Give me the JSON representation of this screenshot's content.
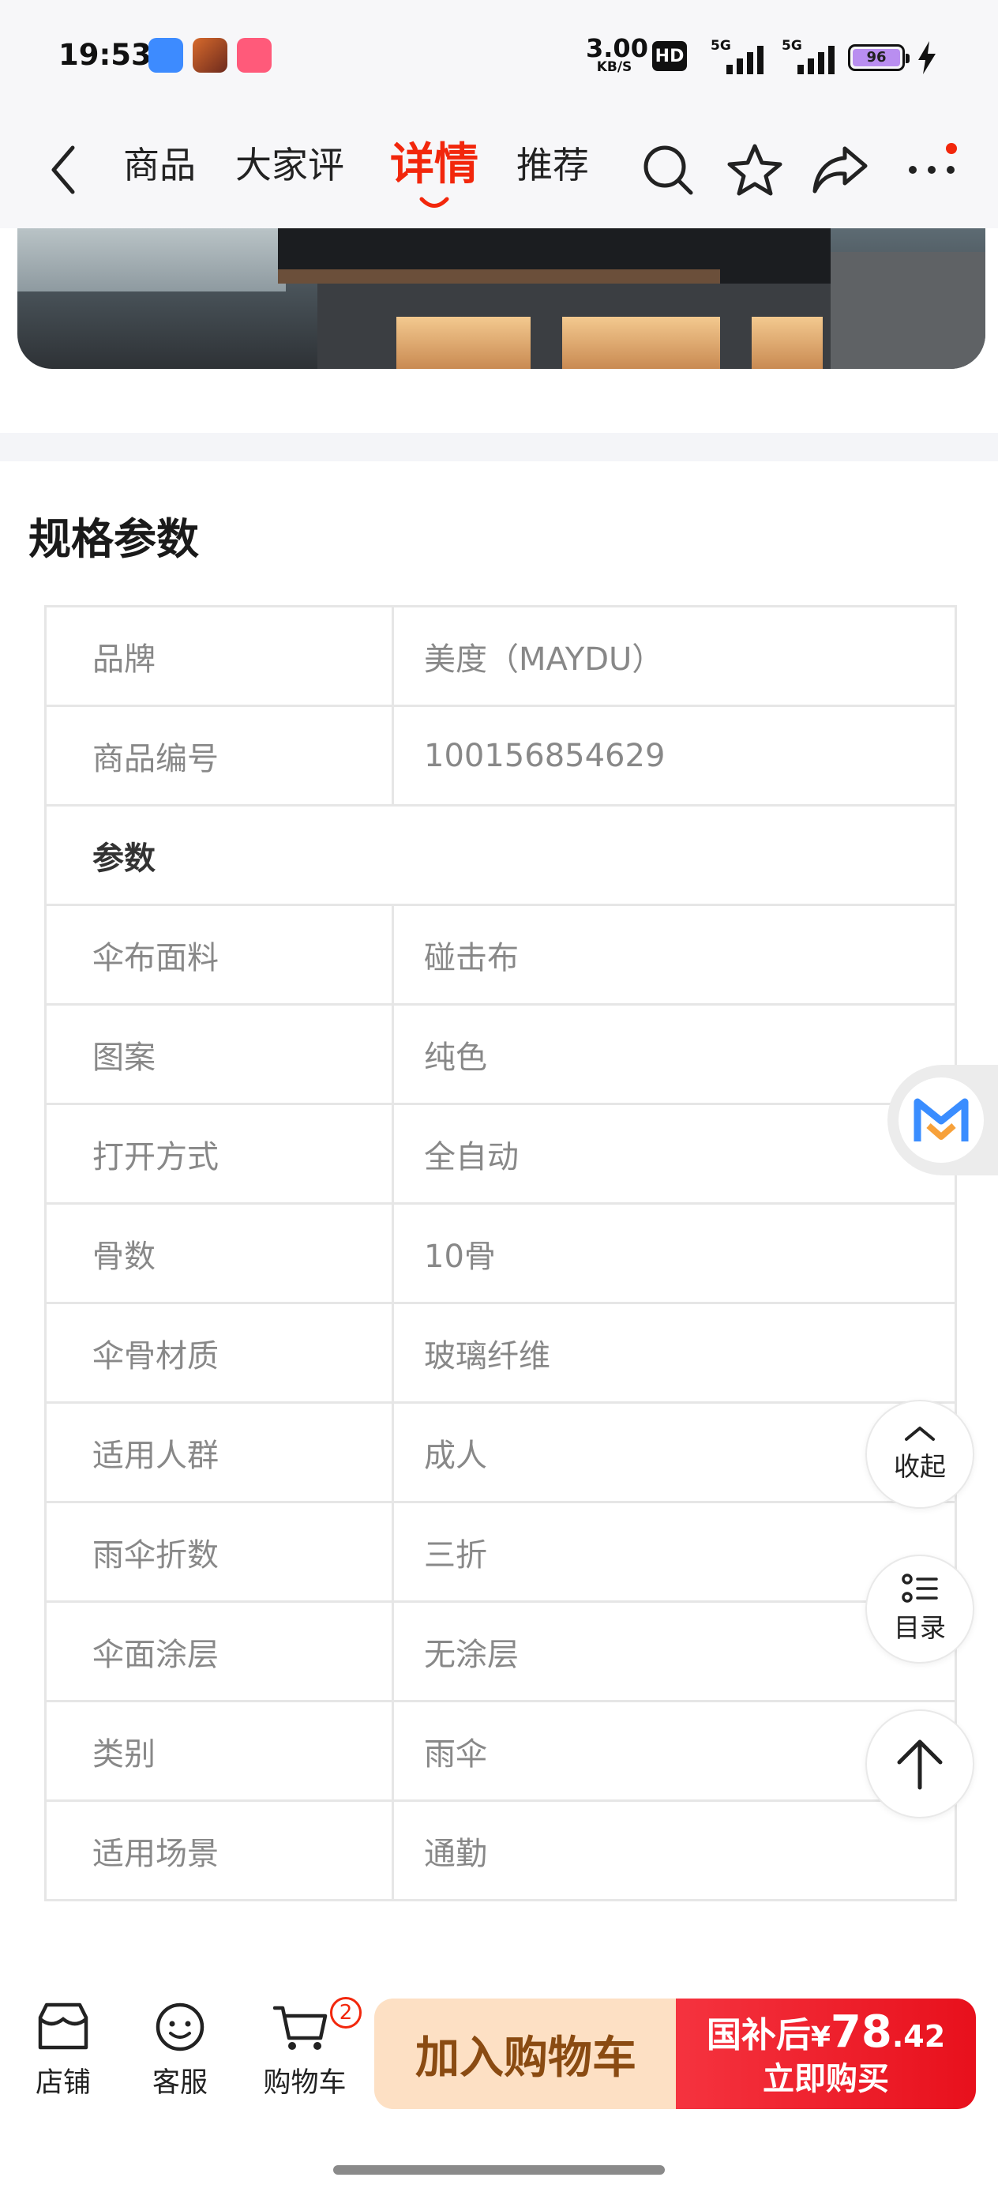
{
  "status_bar": {
    "time": "19:53",
    "net_speed_value": "3.00",
    "net_speed_unit": "KB/S",
    "hd_label": "HD",
    "signal1_label": "5G",
    "signal2_label": "5G",
    "battery_level": "96"
  },
  "nav": {
    "tabs": [
      "商品",
      "大家评",
      "详情",
      "推荐"
    ],
    "active_tab": "详情"
  },
  "spec": {
    "title": "规格参数",
    "rows": [
      {
        "key": "品牌",
        "value": "美度（MAYDU）"
      },
      {
        "key": "商品编号",
        "value": "100156854629"
      },
      {
        "group": "参数"
      },
      {
        "key": "伞布面料",
        "value": "碰击布"
      },
      {
        "key": "图案",
        "value": "纯色"
      },
      {
        "key": "打开方式",
        "value": "全自动"
      },
      {
        "key": "骨数",
        "value": "10骨"
      },
      {
        "key": "伞骨材质",
        "value": "玻璃纤维"
      },
      {
        "key": "适用人群",
        "value": "成人"
      },
      {
        "key": "雨伞折数",
        "value": "三折"
      },
      {
        "key": "伞面涂层",
        "value": "无涂层"
      },
      {
        "key": "类别",
        "value": "雨伞"
      },
      {
        "key": "适用场景",
        "value": "通勤"
      }
    ]
  },
  "floating": {
    "collapse_label": "收起",
    "catalog_label": "目录"
  },
  "bottom_bar": {
    "store_label": "店铺",
    "service_label": "客服",
    "cart_label": "购物车",
    "cart_count": "2",
    "add_to_cart_label": "加入购物车",
    "price_prefix": "国补后",
    "currency": "¥",
    "price_integer": "78",
    "price_decimal": ".42",
    "buy_now_label": "立即购买"
  },
  "colors": {
    "accent": "#f2270c",
    "add_cart_bg": "#fde0c4",
    "add_cart_text": "#8a4b12"
  }
}
